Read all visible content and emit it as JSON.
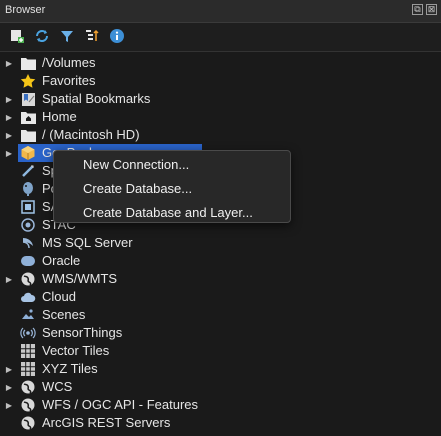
{
  "panel": {
    "title": "Browser",
    "window_buttons": [
      "⧉",
      "⊠"
    ]
  },
  "toolbar": {
    "tools": [
      {
        "icon": "add-layer-icon"
      },
      {
        "icon": "refresh-icon"
      },
      {
        "icon": "filter-icon"
      },
      {
        "icon": "collapse-all-icon"
      },
      {
        "icon": "info-icon"
      }
    ]
  },
  "tree": {
    "items": [
      {
        "label": "/Volumes",
        "icon": "folder-icon",
        "expandable": true
      },
      {
        "label": "Favorites",
        "icon": "star-icon",
        "expandable": false
      },
      {
        "label": "Spatial Bookmarks",
        "icon": "bookmarks-icon",
        "expandable": true
      },
      {
        "label": "Home",
        "icon": "home-icon",
        "expandable": true
      },
      {
        "label": "/ (Macintosh HD)",
        "icon": "folder-icon",
        "expandable": true
      },
      {
        "label": "GeoPackage",
        "icon": "geopackage-icon",
        "expandable": true,
        "selected": true
      },
      {
        "label": "Sp",
        "icon": "spatialite-icon",
        "expandable": false
      },
      {
        "label": "Po",
        "icon": "postgis-icon",
        "expandable": false
      },
      {
        "label": "SA",
        "icon": "sap-hana-icon",
        "expandable": false
      },
      {
        "label": "STAC",
        "icon": "stac-icon",
        "expandable": false
      },
      {
        "label": "MS SQL Server",
        "icon": "mssql-icon",
        "expandable": false
      },
      {
        "label": "Oracle",
        "icon": "oracle-icon",
        "expandable": false
      },
      {
        "label": "WMS/WMTS",
        "icon": "globe-icon",
        "expandable": true
      },
      {
        "label": "Cloud",
        "icon": "cloud-icon",
        "expandable": false
      },
      {
        "label": "Scenes",
        "icon": "scenes-icon",
        "expandable": false
      },
      {
        "label": "SensorThings",
        "icon": "sensorthings-icon",
        "expandable": false
      },
      {
        "label": "Vector Tiles",
        "icon": "grid-icon",
        "expandable": false
      },
      {
        "label": "XYZ Tiles",
        "icon": "grid-icon",
        "expandable": true
      },
      {
        "label": "WCS",
        "icon": "globe-icon",
        "expandable": true
      },
      {
        "label": "WFS / OGC API - Features",
        "icon": "globe-icon",
        "expandable": true
      },
      {
        "label": "ArcGIS REST Servers",
        "icon": "globe-icon",
        "expandable": false
      }
    ]
  },
  "context_menu": {
    "items": [
      {
        "label": "New Connection..."
      },
      {
        "label": "Create Database..."
      },
      {
        "label": "Create Database and Layer..."
      }
    ]
  },
  "colors": {
    "selection": "#2a63c9",
    "folder": "#e8e8e8",
    "star": "#f5c518",
    "geopackage": "#f2b84b"
  }
}
